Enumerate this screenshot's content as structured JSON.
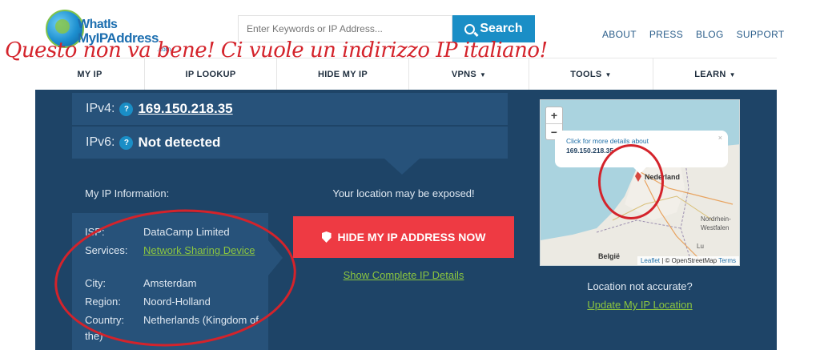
{
  "header": {
    "logo_line1": "WhatIs",
    "logo_line2": "MyIPAddress",
    "logo_com": ".com",
    "search_placeholder": "Enter Keywords or IP Address...",
    "search_button": "Search",
    "top_links": [
      "ABOUT",
      "PRESS",
      "BLOG",
      "SUPPORT"
    ]
  },
  "overlay_text": "Questo non va bene! Ci vuole un indirizzo IP italiano!",
  "nav": [
    {
      "label": "MY IP",
      "dropdown": false
    },
    {
      "label": "IP LOOKUP",
      "dropdown": false
    },
    {
      "label": "HIDE MY IP",
      "dropdown": false
    },
    {
      "label": "VPNS",
      "dropdown": true
    },
    {
      "label": "TOOLS",
      "dropdown": true
    },
    {
      "label": "LEARN",
      "dropdown": true
    }
  ],
  "ip": {
    "ipv4_label": "IPv4:",
    "ipv4_value": "169.150.218.35",
    "ipv6_label": "IPv6:",
    "ipv6_value": "Not detected",
    "help": "?"
  },
  "info": {
    "title": "My IP Information:",
    "isp_label": "ISP:",
    "isp_value": "DataCamp Limited",
    "services_label": "Services:",
    "services_value": "Network Sharing Device",
    "city_label": "City:",
    "city_value": "Amsterdam",
    "region_label": "Region:",
    "region_value": "Noord-Holland",
    "country_label": "Country:",
    "country_value": "Netherlands (Kingdom of the)"
  },
  "action": {
    "exposed_text": "Your location may be exposed!",
    "hide_button": "HIDE MY IP ADDRESS NOW",
    "complete_link": "Show Complete IP Details"
  },
  "map": {
    "zoom_in": "+",
    "zoom_out": "−",
    "popup_line1": "Click for more details about",
    "popup_line2": "169.150.218.35",
    "popup_close": "×",
    "labels": {
      "nederland": "Nederland",
      "belgie": "België",
      "nordrhein": "Nordrhein-",
      "westfalen": "Westfalen",
      "lu": "Lu"
    },
    "attribution_leaflet": "Leaflet",
    "attribution_rest": "| © OpenStreetMap",
    "attribution_terms": "Terms",
    "location_question": "Location not accurate?",
    "update_link": "Update My IP Location"
  },
  "colors": {
    "panel": "#1e4467",
    "panel_light": "#27527a",
    "accent_blue": "#1a8ec6",
    "accent_red": "#ee3a43",
    "link_green": "#8cc63f",
    "annotation_red": "#d4232b"
  }
}
